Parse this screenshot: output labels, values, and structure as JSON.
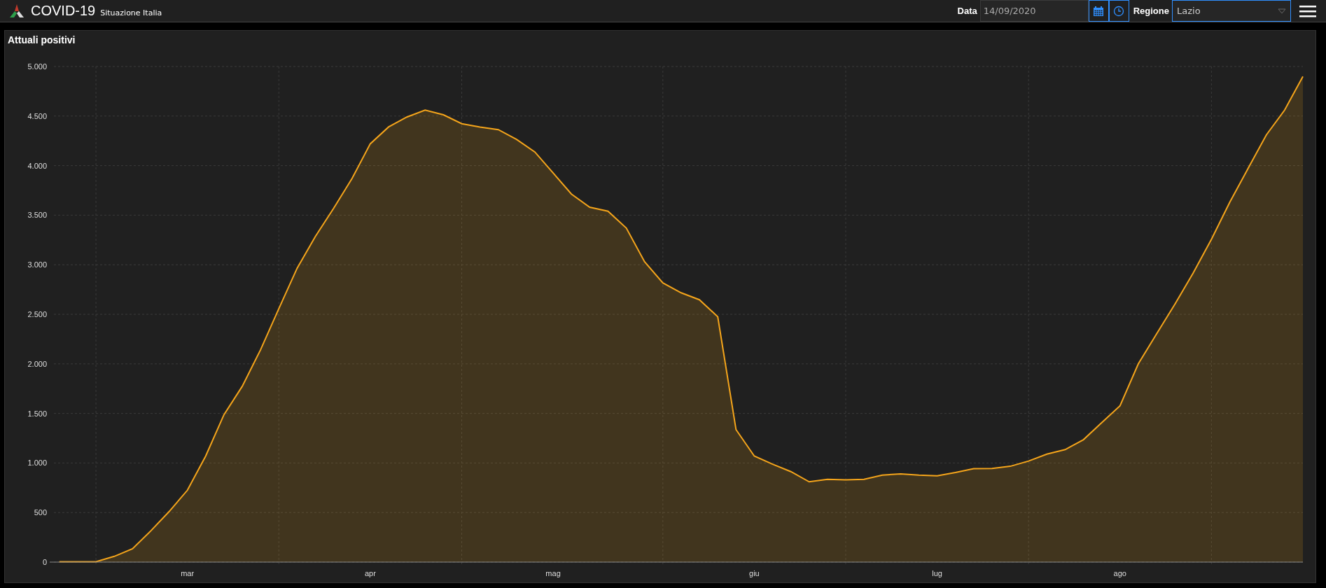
{
  "header": {
    "title": "COVID-19",
    "subtitle": "Situazione Italia",
    "date_label": "Data",
    "date_value": "14/09/2020",
    "region_label": "Regione",
    "region_value": "Lazio"
  },
  "panel": {
    "title": "Attuali positivi",
    "chart_data": {
      "type": "area",
      "categories": [
        null,
        null,
        null,
        null,
        null,
        null,
        null,
        "mar",
        null,
        null,
        null,
        null,
        null,
        null,
        null,
        null,
        null,
        "apr",
        null,
        null,
        null,
        null,
        null,
        null,
        null,
        null,
        null,
        "mag",
        null,
        null,
        null,
        null,
        null,
        null,
        null,
        null,
        null,
        null,
        "giu",
        null,
        null,
        null,
        null,
        null,
        null,
        null,
        null,
        null,
        "lug",
        null,
        null,
        null,
        null,
        null,
        null,
        null,
        null,
        null,
        "ago",
        null,
        null,
        null,
        null,
        null,
        null,
        null,
        null,
        null,
        null
      ],
      "series": [
        {
          "color": "#f5a51b",
          "values": [
            3,
            3,
            4,
            58,
            135,
            315,
            510,
            725,
            1070,
            1487,
            1773,
            2143,
            2558,
            2965,
            3285,
            3570,
            3870,
            4220,
            4390,
            4490,
            4560,
            4513,
            4423,
            4390,
            4363,
            4265,
            4137,
            3925,
            3713,
            3580,
            3540,
            3370,
            3030,
            2817,
            2717,
            2647,
            2475,
            1337,
            1070,
            988,
            913,
            810,
            835,
            830,
            835,
            878,
            890,
            877,
            870,
            903,
            943,
            945,
            967,
            1020,
            1090,
            1135,
            1235,
            1407,
            1577,
            2000,
            2303,
            2603,
            2917,
            3257,
            3630,
            3970,
            4310,
            4560,
            4900
          ]
        }
      ],
      "ylim": [
        0,
        5000
      ],
      "grid": true,
      "yticks": [
        {
          "value": 0,
          "label": "0"
        },
        {
          "value": 500,
          "label": "500"
        },
        {
          "value": 1000,
          "label": "1.000"
        },
        {
          "value": 1500,
          "label": "1.500"
        },
        {
          "value": 2000,
          "label": "2.000"
        },
        {
          "value": 2500,
          "label": "2.500"
        },
        {
          "value": 3000,
          "label": "3.000"
        },
        {
          "value": 3500,
          "label": "3.500"
        },
        {
          "value": 4000,
          "label": "4.000"
        },
        {
          "value": 4500,
          "label": "4.500"
        },
        {
          "value": 5000,
          "label": "5.000"
        }
      ]
    }
  }
}
